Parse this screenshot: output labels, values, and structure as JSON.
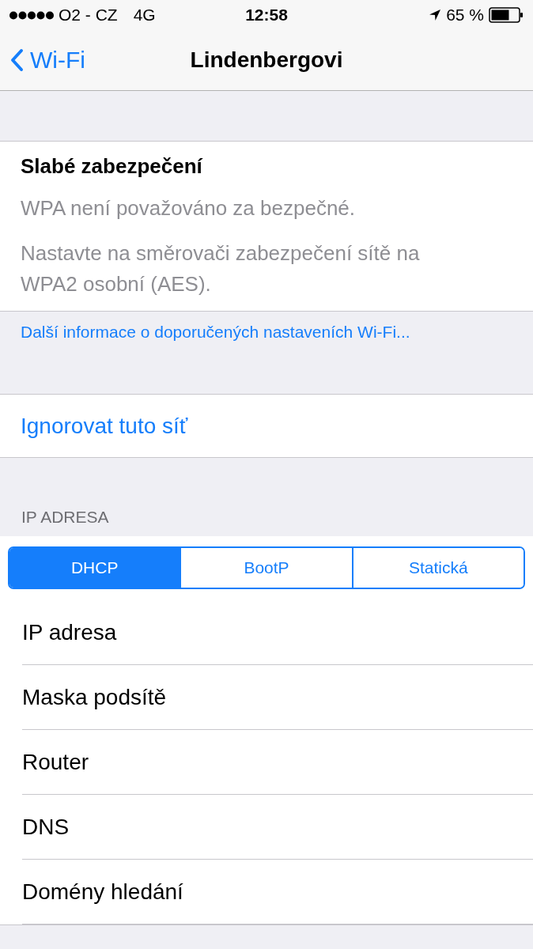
{
  "status_bar": {
    "carrier": "O2 - CZ",
    "network": "4G",
    "time": "12:58",
    "battery": "65 %"
  },
  "nav": {
    "back": "Wi-Fi",
    "title": "Lindenbergovi"
  },
  "warning": {
    "title": "Slabé zabezpečení",
    "lines": [
      "WPA není považováno za bezpečné.",
      "Nastavte na směrovači zabezpečení sítě na WPA2 osobní (AES)."
    ],
    "link": "Další informace o doporučených nastaveních Wi-Fi..."
  },
  "forget": "Ignorovat tuto síť",
  "ip_section": {
    "header": "IP ADRESA",
    "segments": [
      {
        "label": "DHCP",
        "selected": true
      },
      {
        "label": "BootP",
        "selected": false
      },
      {
        "label": "Statická",
        "selected": false
      }
    ],
    "rows": [
      "IP adresa",
      "Maska podsítě",
      "Router",
      "DNS",
      "Domény hledání"
    ]
  }
}
